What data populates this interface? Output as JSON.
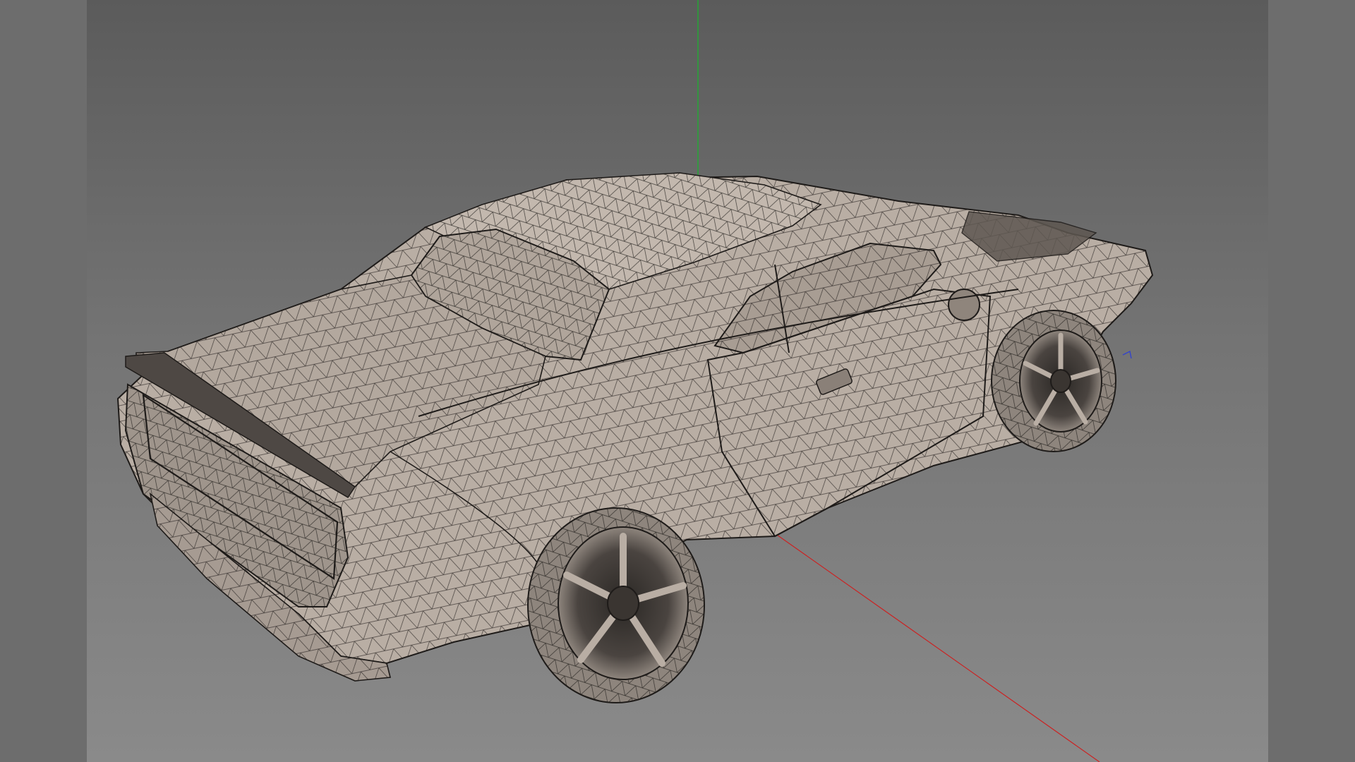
{
  "window": {
    "type": "3d-viewport",
    "display_mode": "wireframe-shaded"
  },
  "scene": {
    "object": "car-mesh",
    "background_color": "#6f6f6f",
    "mesh_fill_color": "#b9aea4",
    "mesh_line_color": "#1e1b19",
    "side_panel_color": "#6d6d6d"
  },
  "axes": {
    "x_color": "#cc2222",
    "y_color": "#22aa33",
    "z_color": "#3344cc"
  }
}
